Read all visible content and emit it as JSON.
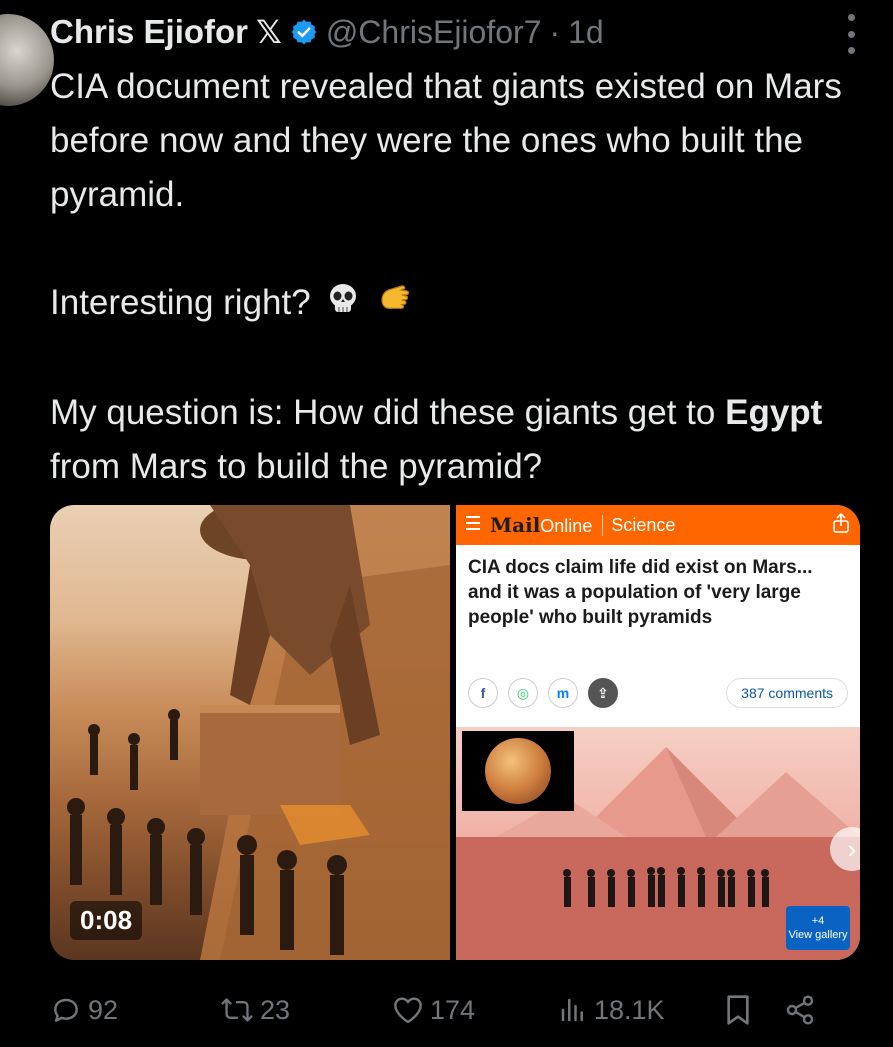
{
  "tweet": {
    "author_name": "Chris Ejiofor",
    "x_mark": "𝕏",
    "handle": "@ChrisEjiofor7",
    "separator": "·",
    "time": "1d",
    "line1": "CIA document revealed that giants existed on Mars before now and they were the ones who built the pyramid.",
    "line2": "Interesting right?",
    "line3_prefix": "My question is: How did these giants get to ",
    "line3_bold": "Egypt",
    "line3_suffix": " from Mars to build the pyramid?"
  },
  "media": {
    "video_duration": "0:08",
    "article": {
      "menu_icon": "menu-icon",
      "brand": "Mail",
      "brand_suffix": "Online",
      "section": "Science",
      "headline": "CIA docs claim life did exist on Mars... and it was a population of 'very large people' who built pyramids",
      "social": [
        "f",
        "◎",
        "m",
        "⇪"
      ],
      "comments": "387 comments",
      "gallery_count": "+4",
      "gallery_label": "View gallery"
    }
  },
  "actions": {
    "replies": "92",
    "reposts": "23",
    "likes": "174",
    "views": "18.1K"
  },
  "colors": {
    "background": "#000000",
    "text": "#e7e9ea",
    "muted": "#71767b",
    "verified": "#1d9bf0",
    "mail_orange": "#ff6600"
  }
}
